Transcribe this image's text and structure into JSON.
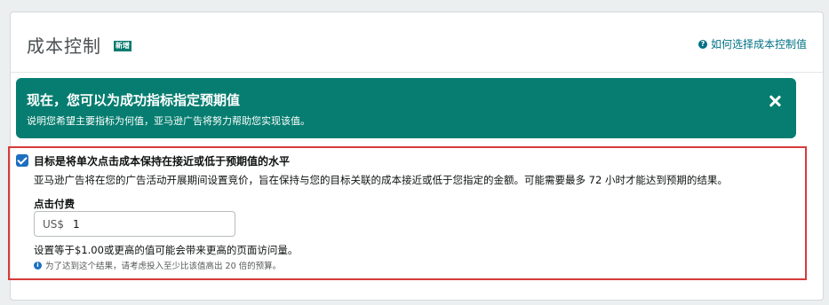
{
  "header": {
    "title": "成本控制",
    "badge": "新增",
    "help_link": "如何选择成本控制值",
    "help_icon": "question-circle-icon"
  },
  "banner": {
    "title": "现在，您可以为成功指标指定预期值",
    "subtitle": "说明您希望主要指标为何值，亚马逊广告将努力帮助您实现该值。",
    "close_icon": "close-icon",
    "color": "#067d70"
  },
  "goal": {
    "checked": true,
    "label": "目标是将单次点击成本保持在接近或低于预期值的水平",
    "description": "亚马逊广告将在您的广告活动开展期间设置竞价，旨在保持与您的目标关联的成本接近或低于您指定的金额。可能需要最多 72 小时才能达到预期的结果。",
    "field_label": "点击付费",
    "currency_prefix": "US$",
    "value": "1",
    "hint": "设置等于$1.00或更高的值可能会带来更高的页面访问量。",
    "info": "为了达到这个结果，请考虑投入至少比该值高出 20 倍的预算。"
  },
  "colors": {
    "accent": "#007185",
    "highlight_border": "#d73b3b",
    "checkbox": "#1e6fbf"
  }
}
